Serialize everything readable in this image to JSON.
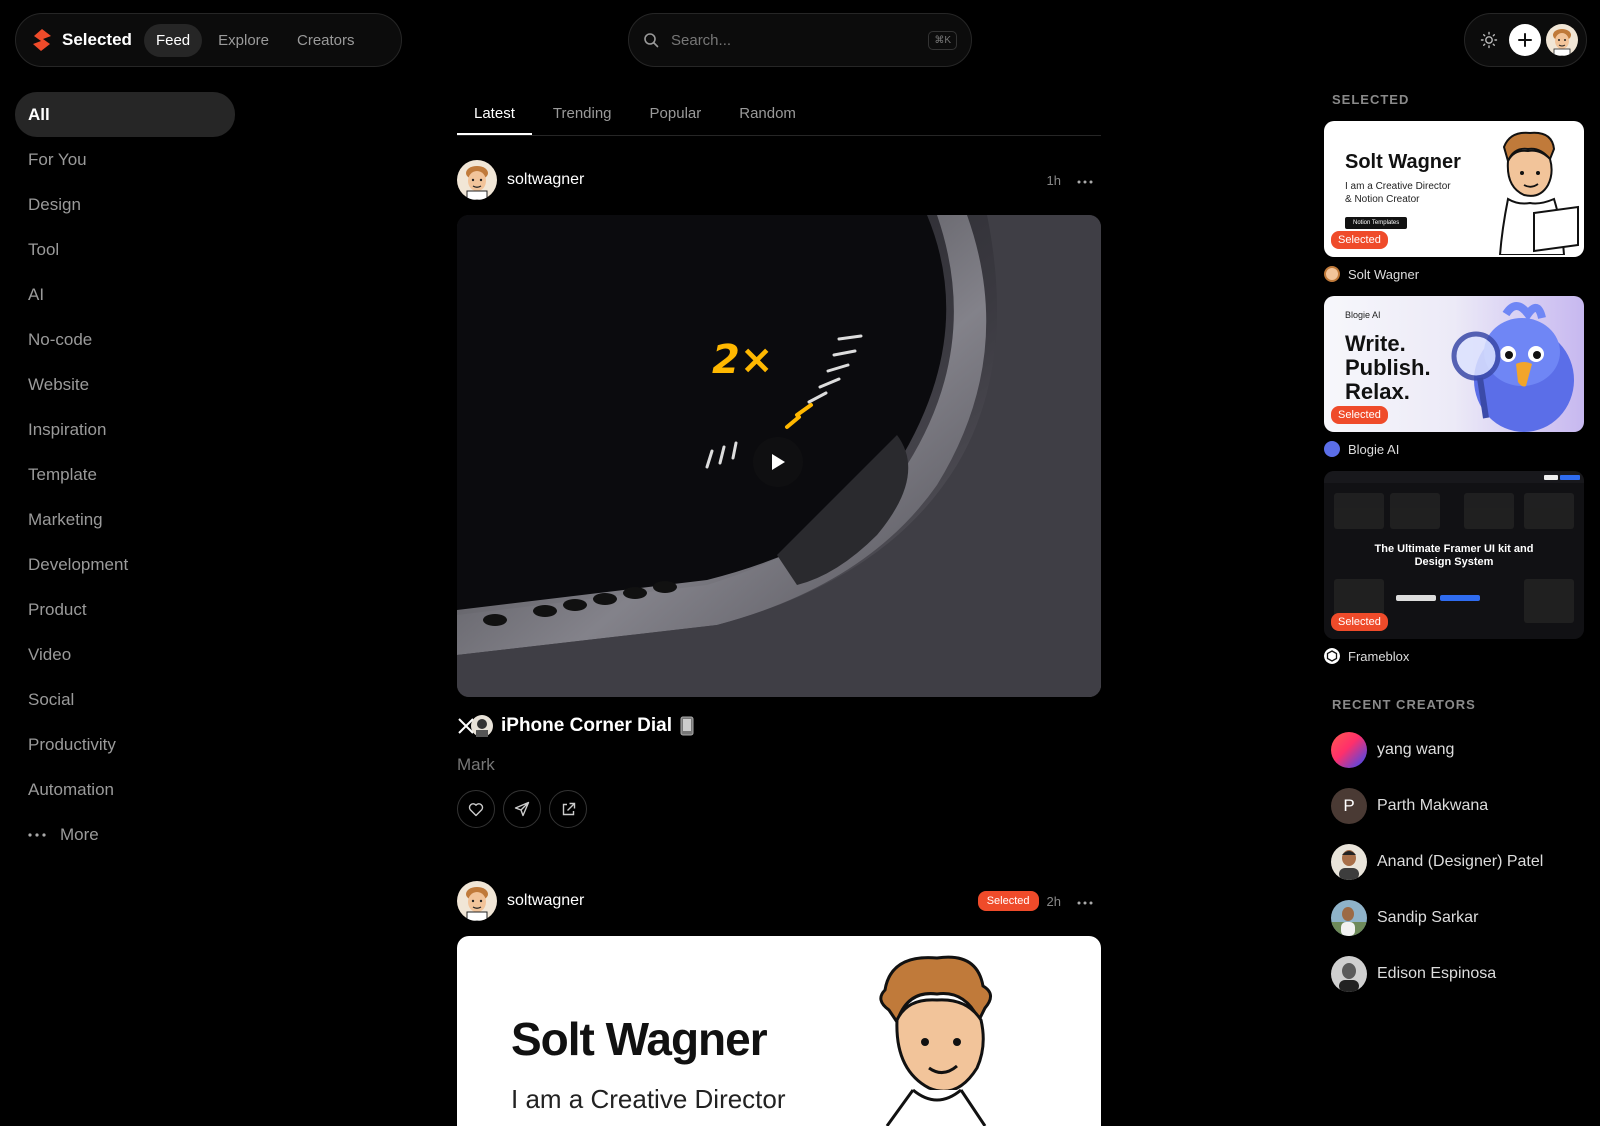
{
  "header": {
    "brand": "Selected",
    "nav": [
      "Feed",
      "Explore",
      "Creators"
    ],
    "search_placeholder": "Search...",
    "search_shortcut": "⌘K"
  },
  "sidebar": {
    "items": [
      "All",
      "For You",
      "Design",
      "Tool",
      "AI",
      "No-code",
      "Website",
      "Inspiration",
      "Template",
      "Marketing",
      "Development",
      "Product",
      "Video",
      "Social",
      "Productivity",
      "Automation"
    ],
    "more_label": "More"
  },
  "feed": {
    "tabs": [
      "Latest",
      "Trending",
      "Popular",
      "Random"
    ],
    "posts": [
      {
        "user": "soltwagner",
        "time": "1h",
        "media_overlay_text": "2×",
        "title": "iPhone Corner Dial",
        "subtitle": "Mark"
      },
      {
        "user": "soltwagner",
        "badge": "Selected",
        "time": "2h",
        "card_name": "Solt Wagner",
        "card_sub": "I am a Creative Director"
      }
    ]
  },
  "right_panel": {
    "selected_heading": "SELECTED",
    "badge": "Selected",
    "selected": [
      {
        "name": "Solt Wagner",
        "card_title": "Solt Wagner",
        "card_line1": "I am a Creative Director",
        "card_line2": "& Notion Creator",
        "card_tag": "Notion Templates"
      },
      {
        "name": "Blogie AI",
        "card_brand": "Blogie AI",
        "card_lines": [
          "Write.",
          "Publish.",
          "Relax."
        ]
      },
      {
        "name": "Frameblox",
        "card_title": "The Ultimate Framer UI kit and Design System"
      }
    ],
    "recent_heading": "RECENT CREATORS",
    "creators": [
      {
        "name": "yang wang"
      },
      {
        "name": "Parth Makwana",
        "initial": "P"
      },
      {
        "name": "Anand (Designer) Patel"
      },
      {
        "name": "Sandip Sarkar"
      },
      {
        "name": "Edison Espinosa"
      }
    ]
  },
  "colors": {
    "accent": "#ef4b2a",
    "background": "#000000",
    "surface": "#262626"
  }
}
